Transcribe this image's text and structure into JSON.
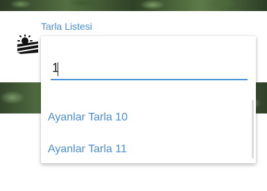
{
  "field": {
    "label": "Tarla Listesi"
  },
  "logo": {
    "icon": "field-sun-icon"
  },
  "search": {
    "value": "1",
    "accent_color": "#4a90d9"
  },
  "options": [
    {
      "label": "Ayanlar Tarla 10"
    },
    {
      "label": "Ayanlar Tarla 11"
    }
  ],
  "colors": {
    "link": "#4a8fd8"
  }
}
